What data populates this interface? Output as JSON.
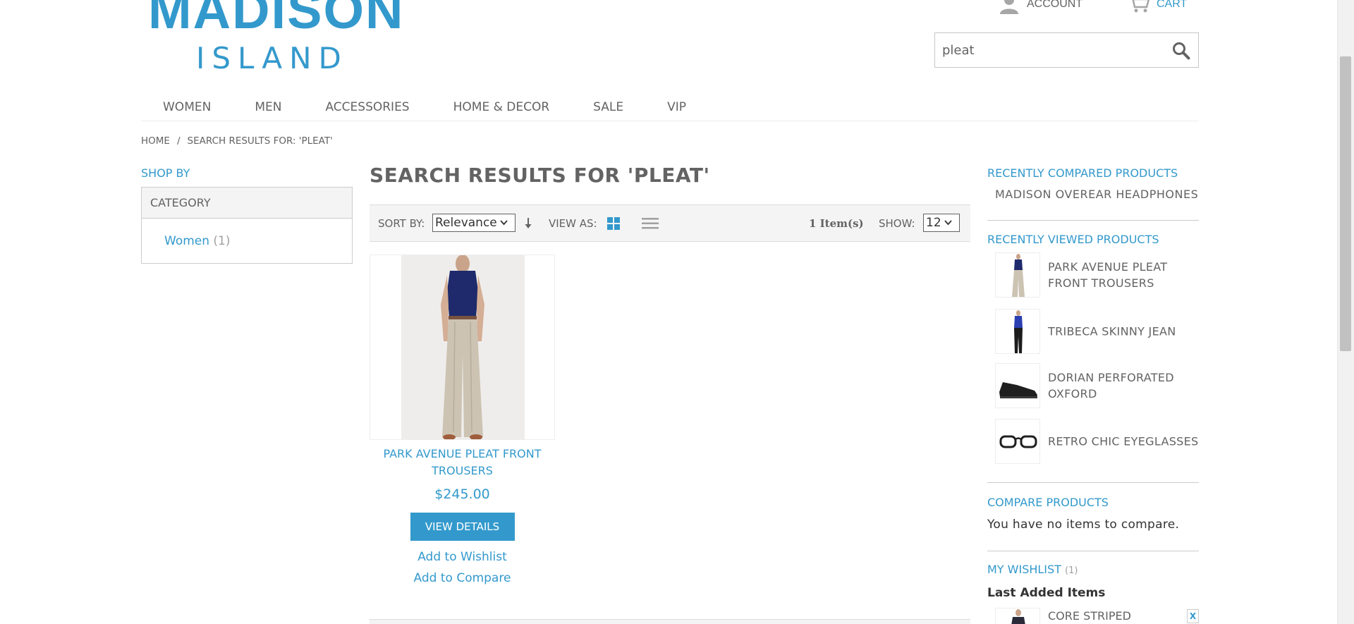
{
  "brand": {
    "main": "MADISON",
    "sub": "ISLAND"
  },
  "header": {
    "account_label": "ACCOUNT",
    "cart_label": "CART"
  },
  "search": {
    "value": "pleat"
  },
  "nav": [
    "WOMEN",
    "MEN",
    "ACCESSORIES",
    "HOME & DECOR",
    "SALE",
    "VIP"
  ],
  "breadcrumb": {
    "home": "HOME",
    "separator": "/",
    "current": "SEARCH RESULTS FOR: 'PLEAT'"
  },
  "sidebar": {
    "shop_by": "SHOP BY",
    "category_title": "CATEGORY",
    "category_item": {
      "label": "Women",
      "count": "(1)"
    }
  },
  "main": {
    "title": "SEARCH RESULTS FOR 'PLEAT'",
    "toolbar": {
      "sort_by_label": "SORT BY:",
      "sort_value": "Relevance",
      "view_as_label": "VIEW AS:",
      "item_count": "1 Item(s)",
      "show_label": "SHOW:",
      "show_value": "12"
    },
    "product": {
      "name": "PARK AVENUE PLEAT FRONT TROUSERS",
      "price": "$245.00",
      "view_details": "VIEW DETAILS",
      "add_to_wishlist": "Add to Wishlist",
      "add_to_compare": "Add to Compare"
    }
  },
  "right": {
    "recently_compared_title": "RECENTLY COMPARED PRODUCTS",
    "recently_compared_item": "MADISON OVEREAR HEADPHONES",
    "recently_viewed_title": "RECENTLY VIEWED PRODUCTS",
    "recently_viewed": [
      "PARK AVENUE PLEAT FRONT TROUSERS",
      "TRIBECA SKINNY JEAN",
      "DORIAN PERFORATED OXFORD",
      "RETRO CHIC EYEGLASSES"
    ],
    "compare_title": "COMPARE PRODUCTS",
    "compare_empty": "You have no items to compare.",
    "wishlist_title": "MY WISHLIST",
    "wishlist_count": "(1)",
    "last_added": "Last Added Items",
    "wishlist_item": "CORE STRIPED",
    "wishlist_remove": "X"
  },
  "colors": {
    "accent": "#3399cc",
    "text": "#636363",
    "toolbar_bg": "#f4f4f4"
  }
}
